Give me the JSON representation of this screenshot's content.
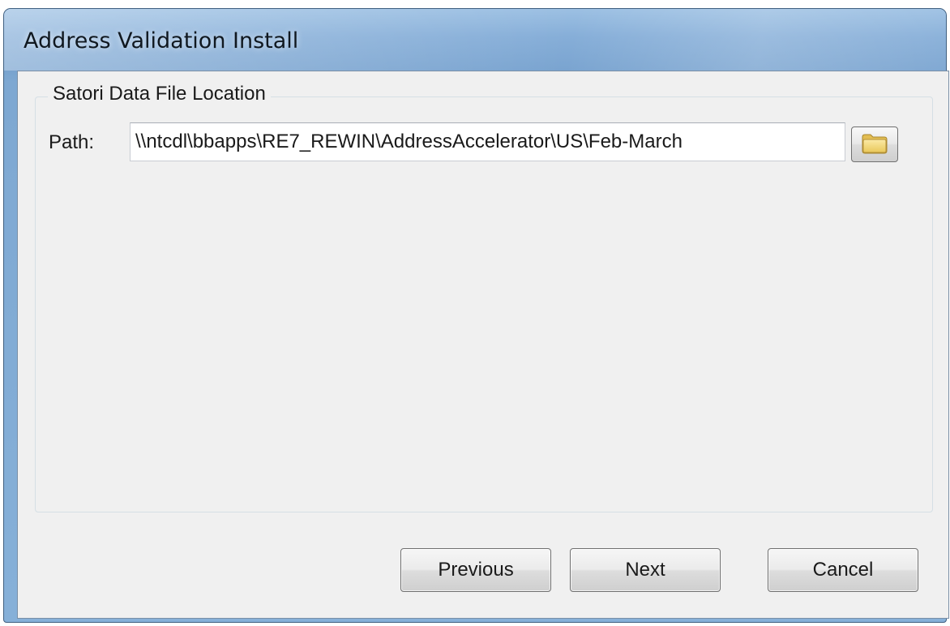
{
  "window": {
    "title": "Address Validation Install"
  },
  "group": {
    "legend": "Satori Data File Location"
  },
  "path": {
    "label": "Path:",
    "value": "\\\\ntcdl\\bbapps\\RE7_REWIN\\AddressAccelerator\\US\\Feb-March"
  },
  "browse": {
    "icon": "folder-icon"
  },
  "buttons": {
    "previous": "Previous",
    "next": "Next",
    "cancel": "Cancel"
  },
  "colors": {
    "titlebar": "#86aed8",
    "client": "#f0f0f0",
    "folder": "#f2d675"
  }
}
